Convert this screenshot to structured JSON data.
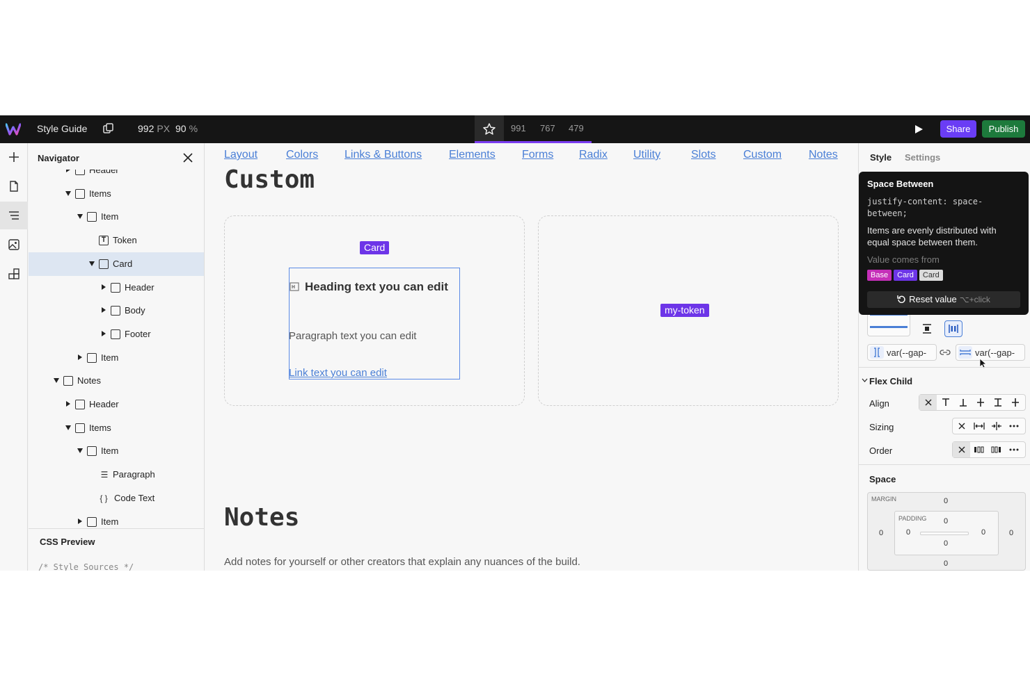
{
  "topbar": {
    "title": "Style Guide",
    "breakpoint_width": "992",
    "breakpoint_unit": "PX",
    "zoom": "90",
    "zoom_unit": "%",
    "breakpoints": [
      "991",
      "767",
      "479"
    ],
    "share_label": "Share",
    "publish_label": "Publish",
    "accent": "#6a3df5",
    "publish_color": "#1d7a3c"
  },
  "navigator": {
    "title": "Navigator",
    "items": [
      {
        "label": "Header",
        "depth": 3,
        "caret": "right",
        "icon": "box"
      },
      {
        "label": "Items",
        "depth": 3,
        "caret": "down",
        "icon": "box"
      },
      {
        "label": "Item",
        "depth": 4,
        "caret": "down",
        "icon": "box"
      },
      {
        "label": "Token",
        "depth": 5,
        "caret": "none",
        "icon": "text"
      },
      {
        "label": "Card",
        "depth": 5,
        "caret": "down",
        "icon": "box",
        "selected": true
      },
      {
        "label": "Header",
        "depth": 6,
        "caret": "right",
        "icon": "box"
      },
      {
        "label": "Body",
        "depth": 6,
        "caret": "right",
        "icon": "box"
      },
      {
        "label": "Footer",
        "depth": 6,
        "caret": "right",
        "icon": "box"
      },
      {
        "label": "Item",
        "depth": 4,
        "caret": "right",
        "icon": "box"
      },
      {
        "label": "Notes",
        "depth": 2,
        "caret": "down",
        "icon": "box"
      },
      {
        "label": "Header",
        "depth": 3,
        "caret": "right",
        "icon": "box"
      },
      {
        "label": "Items",
        "depth": 3,
        "caret": "down",
        "icon": "box"
      },
      {
        "label": "Item",
        "depth": 4,
        "caret": "down",
        "icon": "box"
      },
      {
        "label": "Paragraph",
        "depth": 5,
        "caret": "none",
        "icon": "paragraph"
      },
      {
        "label": "Code Text",
        "depth": 5,
        "caret": "none",
        "icon": "code"
      },
      {
        "label": "Item",
        "depth": 4,
        "caret": "right",
        "icon": "box"
      }
    ],
    "css_preview_title": "CSS Preview",
    "css_preview_code": "/* Style Sources */"
  },
  "canvas": {
    "links": [
      "Layout",
      "Colors",
      "Links & Buttons",
      "Elements",
      "Forms",
      "Radix",
      "Utility",
      "Slots",
      "Custom",
      "Notes"
    ],
    "custom_title": "Custom",
    "card_badge": "Card",
    "heading": "Heading text you can edit",
    "paragraph": "Paragraph text you can edit",
    "link": "Link text you can edit",
    "token_badge": "my-token",
    "notes_title": "Notes",
    "notes_desc": "Add notes for yourself or other creators that explain any nuances of the build."
  },
  "right_panel": {
    "tabs": [
      "Style",
      "Settings"
    ],
    "tooltip": {
      "title": "Space Between",
      "code": "justify-content: space-between;",
      "desc": "Items are evenly distributed with equal space between them.",
      "from_label": "Value comes from",
      "badges": [
        "Base",
        "Card",
        "Card"
      ],
      "reset_label": "Reset value",
      "reset_shortcut": "⌥+click"
    },
    "gap_row": "var(--gap-",
    "gap_col": "var(--gap-",
    "flex_child": {
      "title": "Flex Child",
      "align_label": "Align",
      "sizing_label": "Sizing",
      "order_label": "Order"
    },
    "space": {
      "title": "Space",
      "margin_label": "MARGIN",
      "padding_label": "PADDING",
      "margin_top": "0",
      "margin_right": "0",
      "margin_bottom": "0",
      "margin_left": "0",
      "padding_top": "0",
      "padding_right": "0",
      "padding_bottom": "0",
      "padding_left": "0"
    }
  }
}
